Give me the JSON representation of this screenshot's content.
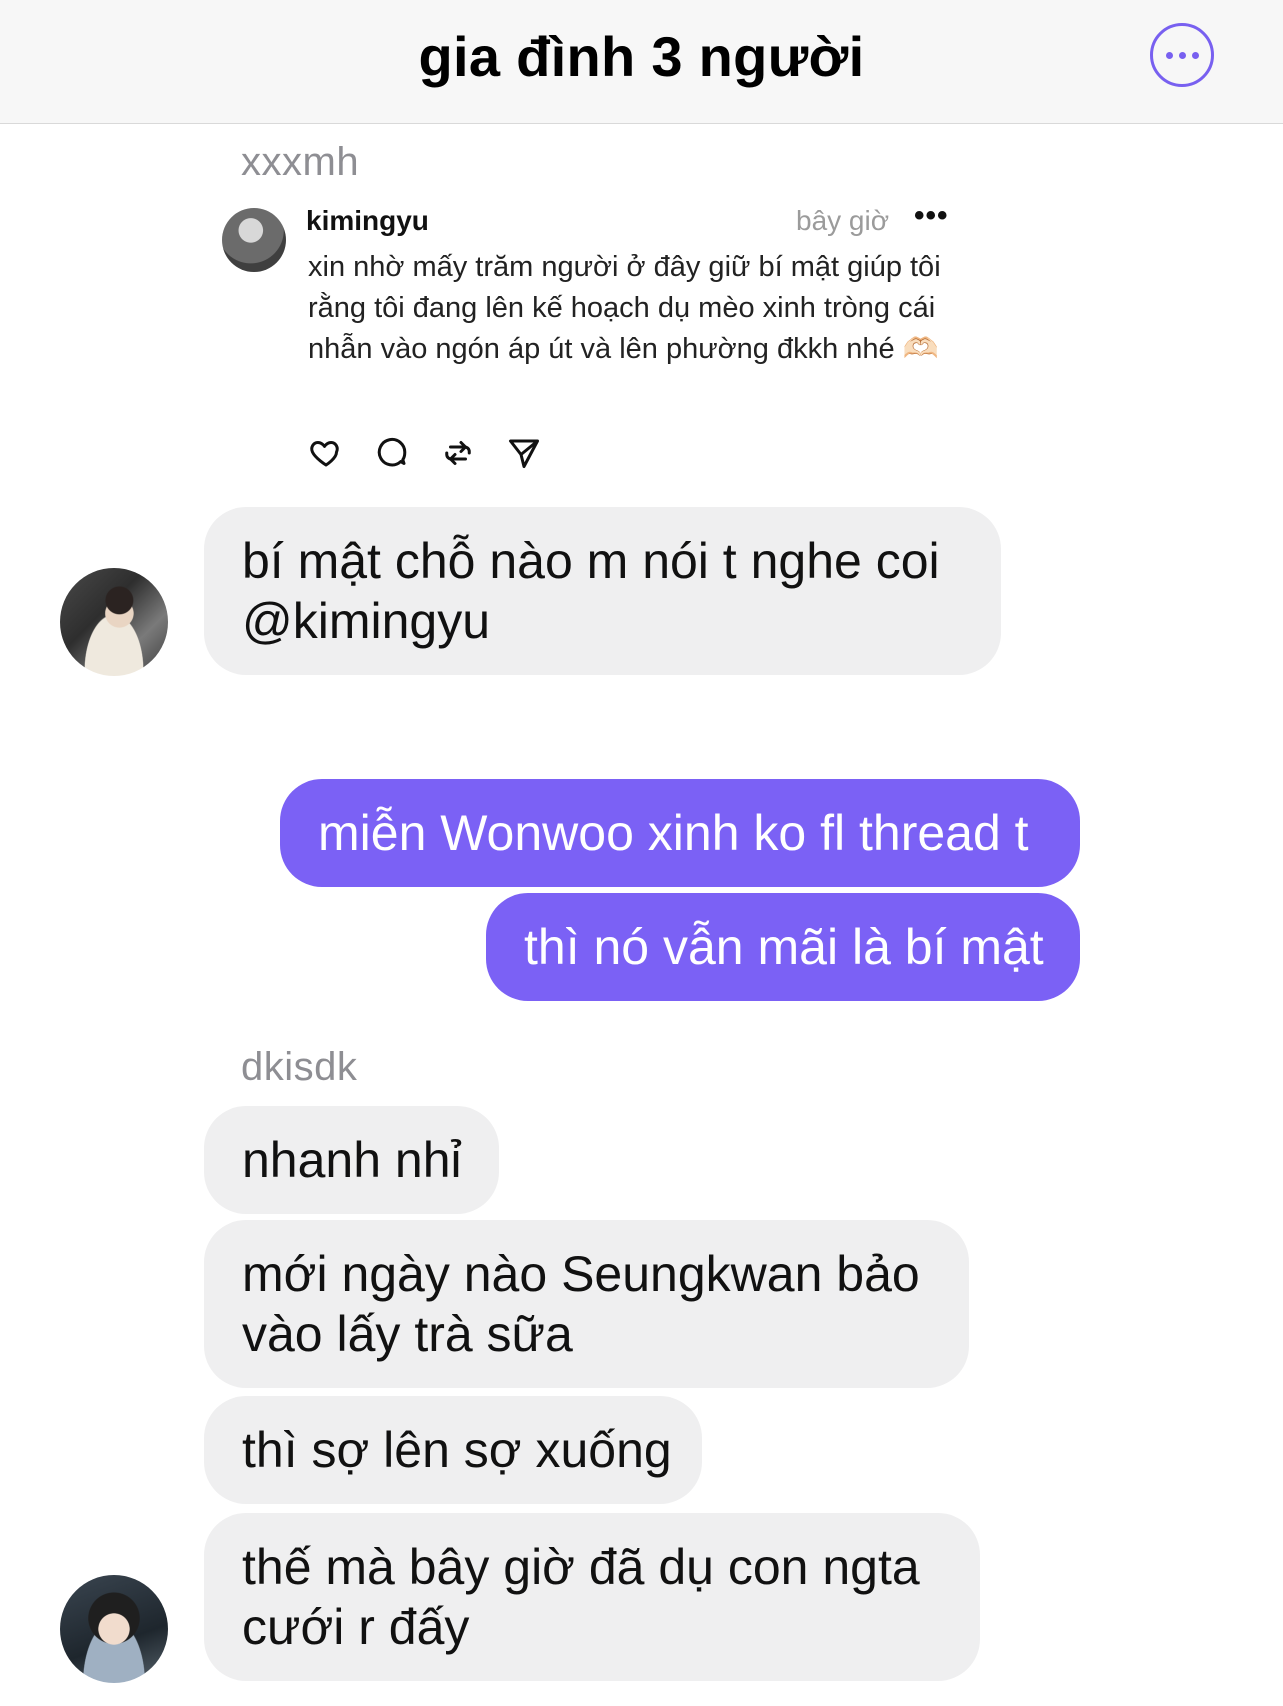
{
  "header": {
    "title": "gia đình 3 người"
  },
  "shared_post": {
    "sender": "xxxmh",
    "thread": {
      "username": "kimingyu",
      "time": "bây giờ",
      "menu": "•••",
      "text": "xin nhờ mấy trăm người ở đây giữ bí mật giúp tôi rằng tôi đang lên kế hoạch dụ mèo xinh tròng cái nhẫn vào ngón áp út và lên phường đkkh nhé 🫶🏻"
    }
  },
  "messages": [
    {
      "from": "xxxmh",
      "lines": [
        "bí mật chỗ nào m nói t nghe coi",
        "@kimingyu"
      ]
    },
    {
      "from": "me",
      "lines": [
        "miễn Wonwoo xinh ko fl thread t"
      ]
    },
    {
      "from": "me",
      "lines": [
        "thì nó vẫn mãi là bí mật"
      ]
    },
    {
      "from": "dkisdk",
      "lines": [
        "nhanh nhỉ"
      ]
    },
    {
      "from": "dkisdk",
      "lines": [
        "mới ngày nào Seungkwan bảo",
        "vào lấy trà sữa"
      ]
    },
    {
      "from": "dkisdk",
      "lines": [
        "thì sợ lên sợ xuống"
      ]
    },
    {
      "from": "dkisdk",
      "lines": [
        "thế mà bây giờ đã dụ con ngta",
        "cưới r đấy"
      ]
    }
  ],
  "senders": {
    "second": "dkisdk"
  },
  "colors": {
    "accent": "#7b61f5",
    "incoming_bubble": "#efeff0",
    "name_gray": "#8e8e93"
  },
  "icons": [
    "more-icon",
    "heart-icon",
    "comment-icon",
    "repost-icon",
    "share-icon"
  ]
}
